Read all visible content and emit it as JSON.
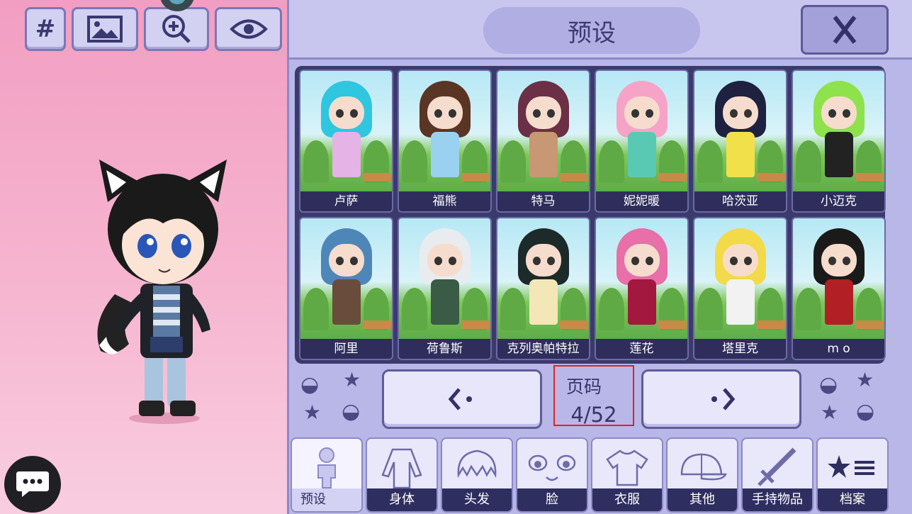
{
  "toolbar": {
    "hash_label": "#",
    "icons": [
      "hash-icon",
      "image-icon",
      "zoom-in-icon",
      "eye-icon"
    ]
  },
  "header": {
    "title": "预设",
    "close_label": "X"
  },
  "presets": [
    {
      "name": "卢萨",
      "hair": "#2fc6e0",
      "outfit": "#e6b3e6"
    },
    {
      "name": "福熊",
      "hair": "#5a3524",
      "outfit": "#9ad1f0"
    },
    {
      "name": "特马",
      "hair": "#6b2f46",
      "outfit": "#c89773"
    },
    {
      "name": "妮妮暖",
      "hair": "#f7a3c8",
      "outfit": "#59c9b3"
    },
    {
      "name": "哈茨亚",
      "hair": "#1e2140",
      "outfit": "#f2e04a"
    },
    {
      "name": "小迈克",
      "hair": "#8ee24c",
      "outfit": "#222222"
    },
    {
      "name": "阿里",
      "hair": "#4f86b8",
      "outfit": "#6a4c3c"
    },
    {
      "name": "荷鲁斯",
      "hair": "#e8ecef",
      "outfit": "#3a5b45"
    },
    {
      "name": "克列奥帕特拉",
      "hair": "#1d2a2a",
      "outfit": "#f4e7b7"
    },
    {
      "name": "莲花",
      "hair": "#e86fa8",
      "outfit": "#a3183e"
    },
    {
      "name": "塔里克",
      "hair": "#f3da48",
      "outfit": "#f2f2f2"
    },
    {
      "name": "m o",
      "hair": "#1a1a1a",
      "outfit": "#b21f24"
    }
  ],
  "pager": {
    "label": "页码",
    "value": "4/52",
    "prev_label": "‹·",
    "next_label": "·›"
  },
  "tabs": [
    {
      "label": "预设",
      "icon": "person-icon",
      "active": true
    },
    {
      "label": "身体",
      "icon": "body-icon"
    },
    {
      "label": "头发",
      "icon": "hair-icon"
    },
    {
      "label": "脸",
      "icon": "face-icon"
    },
    {
      "label": "衣服",
      "icon": "shirt-icon"
    },
    {
      "label": "其他",
      "icon": "cap-icon"
    },
    {
      "label": "手持物品",
      "icon": "sword-icon"
    },
    {
      "label": "档案",
      "icon": "star-list-icon"
    }
  ],
  "colors": {
    "panel": "#b9b7e8",
    "grid_bg": "#3b3a6c",
    "highlight": "#e02222"
  }
}
